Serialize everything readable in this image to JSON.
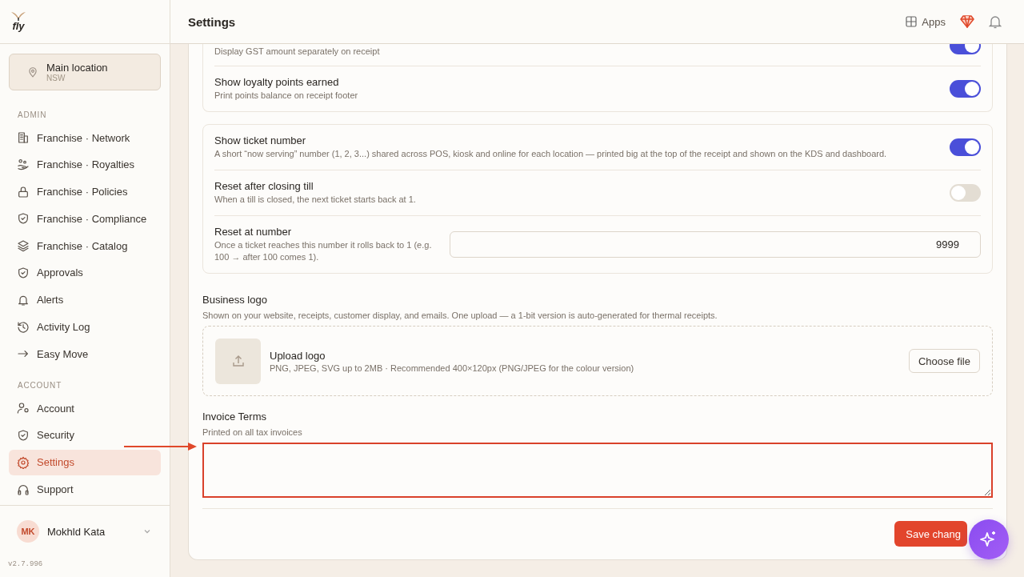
{
  "sidebar": {
    "logo": "fly",
    "location": {
      "name": "Main location",
      "region": "NSW"
    },
    "sections": [
      {
        "title": "ADMIN",
        "items": [
          {
            "label": "Franchise · Network",
            "selected": false
          },
          {
            "label": "Franchise · Royalties",
            "selected": false
          },
          {
            "label": "Franchise · Policies",
            "selected": false
          },
          {
            "label": "Franchise · Compliance",
            "selected": false
          },
          {
            "label": "Franchise · Catalog",
            "selected": false
          },
          {
            "label": "Approvals",
            "selected": false
          },
          {
            "label": "Alerts",
            "selected": false
          },
          {
            "label": "Activity Log",
            "selected": false
          },
          {
            "label": "Easy Move",
            "selected": false
          }
        ]
      },
      {
        "title": "ACCOUNT",
        "items": [
          {
            "label": "Account",
            "selected": false
          },
          {
            "label": "Security",
            "selected": false
          },
          {
            "label": "Settings",
            "selected": true
          },
          {
            "label": "Support",
            "selected": false
          }
        ]
      }
    ],
    "user": {
      "initials": "MK",
      "name": "Mokhld Kata"
    },
    "version": "v2.7.996"
  },
  "header": {
    "title": "Settings",
    "apps": "Apps"
  },
  "cards": [
    {
      "rows": [
        {
          "kind": "toggle",
          "description": "Display GST amount separately on receipt",
          "on": true
        },
        {
          "kind": "toggle",
          "title": "Show loyalty points earned",
          "description": "Print points balance on receipt footer",
          "on": true
        }
      ]
    },
    {
      "rows": [
        {
          "kind": "toggle",
          "title": "Show ticket number",
          "description": "A short “now serving” number (1, 2, 3...) shared across POS, kiosk and online for each location — printed big at the top of the receipt and shown on the KDS and dashboard.",
          "on": true
        },
        {
          "kind": "toggle",
          "title": "Reset after closing till",
          "description": "When a till is closed, the next ticket starts back at 1.",
          "on": false
        },
        {
          "kind": "number",
          "title": "Reset at number",
          "description": "Once a ticket reaches this number it rolls back to 1 (e.g. 100 → after 100 comes 1).",
          "value": "9999"
        }
      ]
    }
  ],
  "logo_section": {
    "title": "Business logo",
    "description": "Shown on your website, receipts, customer display, and emails. One upload — a 1-bit version is auto-generated for thermal receipts.",
    "upload_title": "Upload logo",
    "upload_hint": "PNG, JPEG, SVG up to 2MB · Recommended 400×120px (PNG/JPEG for the colour version)",
    "button": "Choose file"
  },
  "invoice_terms": {
    "title": "Invoice Terms",
    "description": "Printed on all tax invoices"
  },
  "save_button": "Save chang"
}
